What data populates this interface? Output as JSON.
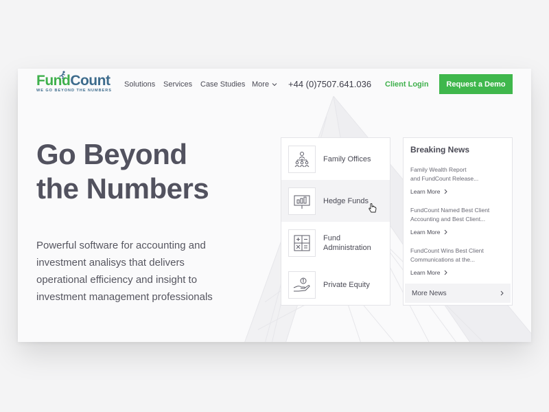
{
  "header": {
    "logo_fund": "Fund",
    "logo_count": "Count",
    "logo_tagline": "WE GO BEYOND THE NUMBERS",
    "nav": [
      {
        "label": "Solutions"
      },
      {
        "label": "Services"
      },
      {
        "label": "Case Studies"
      },
      {
        "label": "More"
      }
    ],
    "phone": "+44 (0)7507.641.036",
    "client_login": "Client Login",
    "demo_button": "Request a Demo"
  },
  "hero": {
    "title_line1": "Go Beyond",
    "title_line2": "the Numbers",
    "subtitle": "Powerful software for accounting and investment analisys that delivers operational efficiency and insight to investment management professionals"
  },
  "services": [
    {
      "label": "Family Offices",
      "icon": "family-icon"
    },
    {
      "label": "Hedge Funds",
      "icon": "presentation-chart-icon"
    },
    {
      "label": "Fund Administration",
      "icon": "calculator-icon"
    },
    {
      "label": "Private Equity",
      "icon": "hand-coin-icon"
    }
  ],
  "news": {
    "title": "Breaking News",
    "items": [
      {
        "line1": "Family Wealth Report",
        "line2": "and FundCount Release...",
        "link": "Learn More"
      },
      {
        "line1": "FundCount Named Best Client",
        "line2": "Accounting and Best Client...",
        "link": "Learn More"
      },
      {
        "line1": "FundCount Wins Best Client",
        "line2": "Communications at the...",
        "link": "Learn More"
      }
    ],
    "more": "More News"
  },
  "colors": {
    "brand_green": "#3fb74c",
    "brand_blue": "#3d6b8c",
    "text": "#4a4a55"
  }
}
